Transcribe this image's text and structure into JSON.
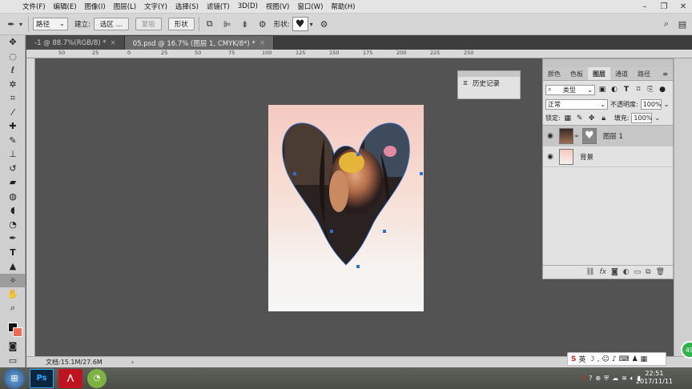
{
  "menubar": {
    "items": [
      "文件(F)",
      "编辑(E)",
      "图像(I)",
      "图层(L)",
      "文字(Y)",
      "选择(S)",
      "滤镜(T)",
      "3D(D)",
      "视图(V)",
      "窗口(W)",
      "帮助(H)"
    ]
  },
  "options": {
    "mode_select": "路径",
    "build_label": "建立:",
    "selection_btn": "选区 ...",
    "mask_btn": "蒙版",
    "shape_btn": "形状",
    "shape_label": "形状:"
  },
  "tabs": [
    {
      "label": "-1 @ 88.7%(RGB/8) *",
      "active": false
    },
    {
      "label": "05.psd @ 16.7% (图层 1, CMYK/8*) *",
      "active": true
    }
  ],
  "ruler": {
    "marks": [
      "50",
      "25",
      "0",
      "25",
      "50",
      "75",
      "100",
      "125",
      "150",
      "175",
      "200",
      "225",
      "250"
    ]
  },
  "history_panel": {
    "title": "历史记录"
  },
  "layers_panel": {
    "tabs": [
      "颜色",
      "色板",
      "图层",
      "通道",
      "路径"
    ],
    "active_tab": "图层",
    "filter_kind": "类型",
    "blend_mode": "正常",
    "opacity_label": "不透明度:",
    "opacity_value": "100%",
    "lock_label": "锁定:",
    "fill_label": "填充:",
    "fill_value": "100%",
    "layers": [
      {
        "name": "图层 1",
        "selected": true
      },
      {
        "name": "背景",
        "selected": false
      }
    ],
    "bottom_icons": [
      "link-icon",
      "fx-icon",
      "mask-icon",
      "adjustment-icon",
      "folder-icon",
      "new-layer-icon",
      "trash-icon"
    ]
  },
  "status": {
    "doc_size": "文档:15.1M/27.6M"
  },
  "taskbar": {
    "apps": [
      "Ps"
    ],
    "ime_label": "英",
    "time": "22:51",
    "date": "2017/11/11",
    "badge": "49"
  },
  "colors": {
    "foreground": "#111111",
    "background": "#ef6a4f",
    "accent": "#2f6fd1"
  }
}
